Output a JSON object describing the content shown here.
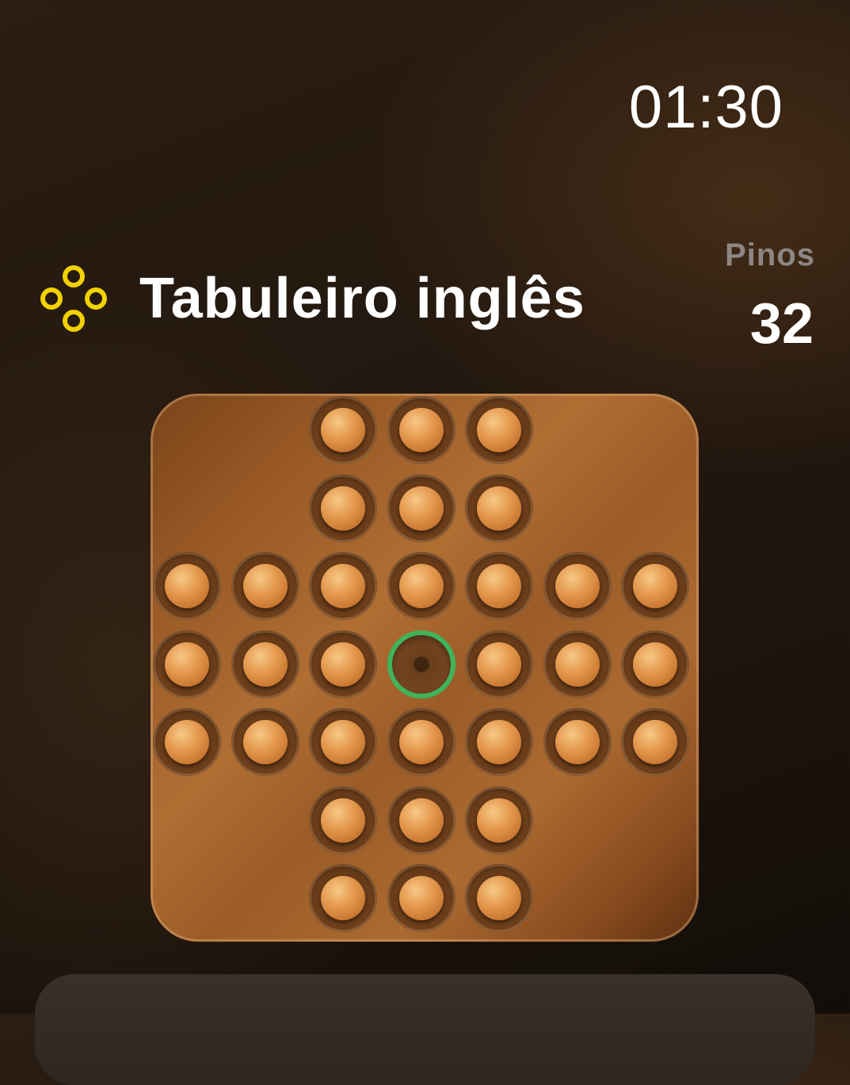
{
  "status": {
    "time": "01:30"
  },
  "header": {
    "title": "Tabuleiro inglês",
    "icon": "four-circles-icon",
    "icon_color": "#f2d100"
  },
  "counter": {
    "label": "Pinos",
    "value": "32"
  },
  "board": {
    "type": "english",
    "size": 7,
    "selected_cell": [
      3,
      3
    ],
    "selection_color": "#3fb45a",
    "rows": [
      [
        null,
        null,
        1,
        1,
        1,
        null,
        null
      ],
      [
        null,
        null,
        1,
        1,
        1,
        null,
        null
      ],
      [
        1,
        1,
        1,
        1,
        1,
        1,
        1
      ],
      [
        1,
        1,
        1,
        0,
        1,
        1,
        1
      ],
      [
        1,
        1,
        1,
        1,
        1,
        1,
        1
      ],
      [
        null,
        null,
        1,
        1,
        1,
        null,
        null
      ],
      [
        null,
        null,
        1,
        1,
        1,
        null,
        null
      ]
    ]
  }
}
